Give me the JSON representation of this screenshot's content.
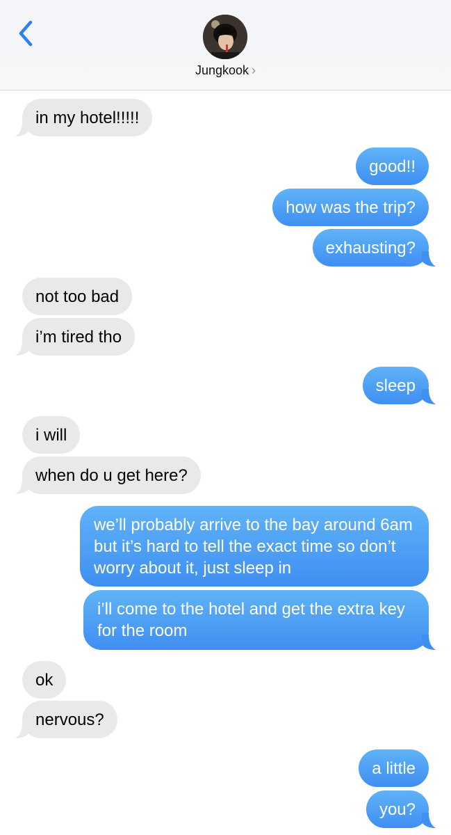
{
  "header": {
    "back_icon": "chevron-left-icon",
    "contact_name": "Jungkook",
    "contact_chevron": "›",
    "avatar_icon": "contact-avatar"
  },
  "colors": {
    "incoming_bubble": "#e9e9eb",
    "outgoing_bubble_top": "#5fb3f7",
    "outgoing_bubble_bottom": "#3f8ef2",
    "accent": "#2f80ed"
  },
  "messages": [
    {
      "text": "in my hotel!!!!!",
      "from": "them"
    },
    {
      "text": "good!!",
      "from": "me"
    },
    {
      "text": "how was the trip?",
      "from": "me"
    },
    {
      "text": "exhausting?",
      "from": "me"
    },
    {
      "text": "not too bad",
      "from": "them"
    },
    {
      "text": "i’m tired tho",
      "from": "them"
    },
    {
      "text": "sleep",
      "from": "me"
    },
    {
      "text": "i will",
      "from": "them"
    },
    {
      "text": "when do u get here?",
      "from": "them"
    },
    {
      "text": "we’ll probably arrive to the bay around 6am but it’s hard to tell the exact time so don’t worry about it, just sleep in",
      "from": "me"
    },
    {
      "text": "i’ll come to the hotel and get the extra key for the room",
      "from": "me"
    },
    {
      "text": "ok",
      "from": "them"
    },
    {
      "text": "nervous?",
      "from": "them"
    },
    {
      "text": "a little",
      "from": "me"
    },
    {
      "text": "you?",
      "from": "me"
    }
  ]
}
